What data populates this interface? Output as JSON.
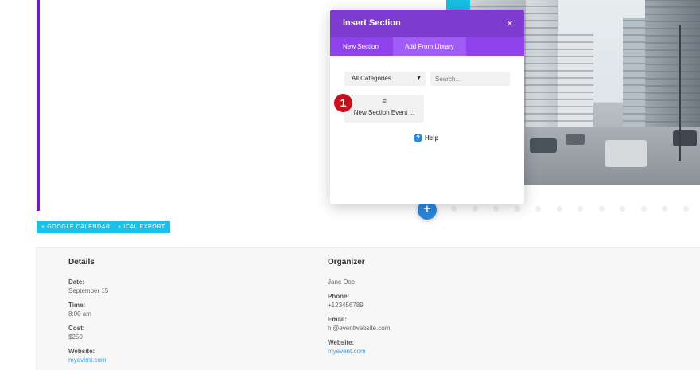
{
  "modal": {
    "title": "Insert Section",
    "close_icon": "×",
    "tabs": [
      {
        "label": "New Section",
        "active": false
      },
      {
        "label": "Add From Library",
        "active": true
      }
    ],
    "category_select": {
      "value": "All Categories",
      "caret": "▼"
    },
    "search": {
      "placeholder": "Search..."
    },
    "library_items": [
      {
        "label": "New Section Event ...",
        "icon": "≡"
      }
    ],
    "help": {
      "icon": "?",
      "label": "Help"
    }
  },
  "step_badge": "1",
  "add_button": "+",
  "calendar_buttons": {
    "google": "+ Google Calendar",
    "ical": "+ iCal Export"
  },
  "details": {
    "heading": "Details",
    "fields": [
      {
        "label": "Date:",
        "value": "September 15"
      },
      {
        "label": "Time:",
        "value": "8:00 am"
      },
      {
        "label": "Cost:",
        "value": "$250"
      },
      {
        "label": "Website:",
        "value": "myevent.com"
      }
    ]
  },
  "organizer": {
    "heading": "Organizer",
    "name": "Jane Doe",
    "fields": [
      {
        "label": "Phone:",
        "value": "+123456789"
      },
      {
        "label": "Email:",
        "value": "hi@eventwebsite.com"
      },
      {
        "label": "Website:",
        "value": "myevent.com"
      }
    ]
  },
  "colors": {
    "accent_purple": "#7b16c6",
    "modal_header": "#7e3bd0",
    "modal_tabs": "#8f42ec",
    "cyan_button": "#1bbfe9",
    "blue_add": "#2b87da",
    "badge_red": "#c5111c",
    "link_blue": "#2ea3f2"
  }
}
